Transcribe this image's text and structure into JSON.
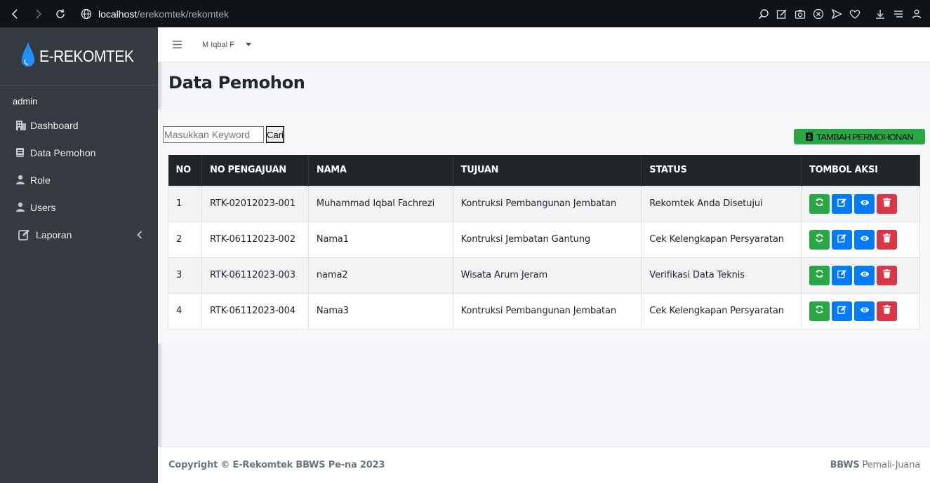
{
  "browser": {
    "url_host": "localhost",
    "url_path": "/erekomtek/rekomtek"
  },
  "sidebar": {
    "brand": "E-REKOMTEK",
    "user": "admin",
    "items": [
      {
        "label": "Dashboard",
        "icon": "building-icon"
      },
      {
        "label": "Data Pemohon",
        "icon": "book-icon"
      },
      {
        "label": "Role",
        "icon": "user-icon"
      },
      {
        "label": "Users",
        "icon": "user-icon"
      },
      {
        "label": "Laporan",
        "icon": "edit-icon"
      }
    ]
  },
  "topbar": {
    "user_name": "M Iqbal F"
  },
  "page": {
    "title": "Data Pemohon"
  },
  "search": {
    "placeholder": "Masukkan Keyword",
    "button": "Cari"
  },
  "add_button": "TAMBAH PERMOHONAN",
  "table": {
    "headers": [
      "NO",
      "NO PENGAJUAN",
      "NAMA",
      "TUJUAN",
      "STATUS",
      "TOMBOL AKSI"
    ],
    "rows": [
      {
        "no": "1",
        "code": "RTK-02012023-001",
        "name": "Muhammad Iqbal Fachrezi",
        "purpose": "Kontruksi Pembangunan Jembatan",
        "status": "Rekomtek Anda Disetujui"
      },
      {
        "no": "2",
        "code": "RTK-06112023-002",
        "name": "Nama1",
        "purpose": "Kontruksi Jembatan Gantung",
        "status": "Cek Kelengkapan Persyaratan"
      },
      {
        "no": "3",
        "code": "RTK-06112023-003",
        "name": "nama2",
        "purpose": "Wisata Arum Jeram",
        "status": "Verifikasi Data Teknis"
      },
      {
        "no": "4",
        "code": "RTK-06112023-004",
        "name": "Nama3",
        "purpose": "Kontruksi Pembangunan Jembatan",
        "status": "Cek Kelengkapan Persyaratan"
      }
    ]
  },
  "footer": {
    "copyright": "Copyright © E-Rekomtek BBWS Pe-na 2023",
    "org_bold": "BBWS",
    "org_rest": " Pemali-Juana"
  },
  "colors": {
    "sidebar": "#343a40",
    "success": "#28a745",
    "primary": "#007bff",
    "danger": "#dc3545",
    "table_head": "#212529"
  }
}
